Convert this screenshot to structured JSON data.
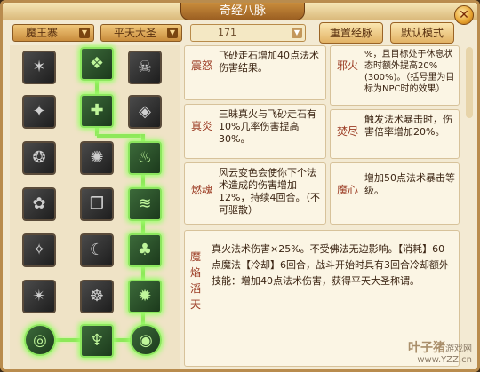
{
  "title": "奇经八脉",
  "close_label": "✕",
  "filters": {
    "faction": "魔王寨",
    "school": "平天大圣",
    "points": "171",
    "reset_label": "重置经脉",
    "default_label": "默认模式"
  },
  "skills": [
    {
      "label": "震怒",
      "text": "飞砂走石增加40点法术伤害结果。"
    },
    {
      "label": "邪火",
      "text": "%，且目标处于休息状态时额外提高20%(300%)。（括号里为目标为NPC时的效果）"
    },
    {
      "label": "真炎",
      "text": "三昧真火与飞砂走石有10%几率伤害提高30%。"
    },
    {
      "label": "焚尽",
      "text": "触发法术暴击时，伤害倍率增加20%。"
    },
    {
      "label": "燃魂",
      "text": "风云变色会使你下个法术造成的伤害增加12%，持续4回合。（不可驱散）"
    },
    {
      "label": "魔心",
      "text": "增加50点法术暴击等级。"
    },
    {
      "label": "魔焰滔天",
      "text": "真火法术伤害×25%。不受佛法无边影响。【消耗】60点魔法【冷却】6回合，战斗开始时具有3回合冷却额外技能：增加40点法术伤害，获得平天大圣称谓。"
    }
  ],
  "watermark": {
    "brand": "叶子猪",
    "sub": "游戏网",
    "url": "www.YZZ.cn"
  }
}
